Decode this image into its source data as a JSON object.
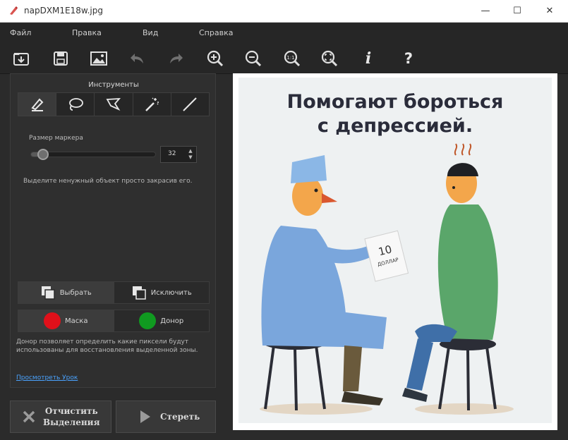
{
  "window": {
    "title": "napDXM1E18w.jpg",
    "minimize_glyph": "—",
    "maximize_glyph": "☐",
    "close_glyph": "✕"
  },
  "menu": [
    "Файл",
    "Правка",
    "Вид",
    "Справка"
  ],
  "toolbar": {
    "icons": [
      "open-icon",
      "save-icon",
      "image-icon",
      "undo-icon",
      "redo-icon",
      "zoom-in-icon",
      "zoom-out-icon",
      "zoom-1to1-icon",
      "zoom-fit-icon",
      "info-icon",
      "help-icon"
    ],
    "zoom_1to1_text": "1:1",
    "info_text": "i",
    "help_text": "?"
  },
  "tools_panel": {
    "header": "Инструменты",
    "tools": [
      "pencil-icon",
      "lasso-icon",
      "polygon-lasso-icon",
      "magic-wand-icon",
      "line-icon"
    ],
    "active_tool": 0,
    "marker_size_label": "Размер маркера",
    "marker_size_value": "32",
    "marker_size_fraction": 0.12,
    "hint": "Выделите ненужный объект просто закрасив его."
  },
  "selection_mode": {
    "select_label": "Выбрать",
    "exclude_label": "Исключить",
    "active": "select"
  },
  "brush_mode": {
    "mask_label": "Маска",
    "donor_label": "Донор",
    "mask_color": "#e0101a",
    "donor_color": "#109a20",
    "active": "mask"
  },
  "donor_hint": "Донор позволяет определить какие пиксели будут использованы для восстановления выделенной зоны.",
  "video_link": "Просмотреть Урок",
  "actions": {
    "clear_label_1": "Отчистить",
    "clear_label_2": "Выделения",
    "erase_label": "Стереть"
  },
  "poster": {
    "title_line1": "Помогают бороться",
    "title_line2": "с депрессией.",
    "note_line1": "10",
    "note_line2": "ДОЛЛАР"
  }
}
